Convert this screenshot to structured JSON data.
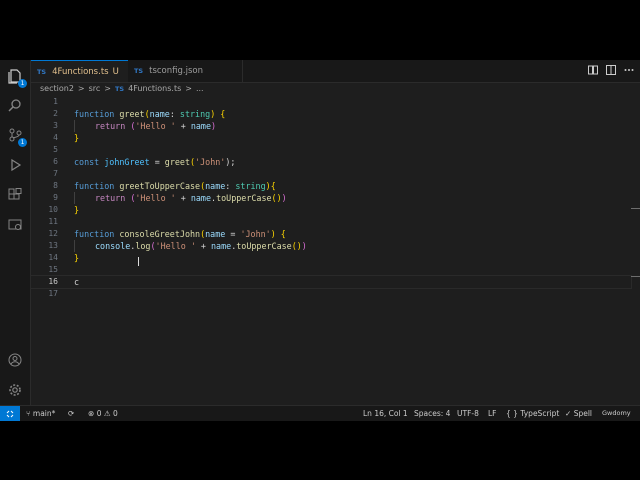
{
  "tabs": [
    {
      "badge": "TS",
      "label": "4Functions.ts",
      "modified": "U"
    },
    {
      "badge": "TS",
      "label": "tsconfig.json"
    }
  ],
  "breadcrumb": [
    "section2",
    ">",
    "src",
    ">",
    "TS",
    "4Functions.ts",
    ">",
    "..."
  ],
  "activity": {
    "explorer_badge": "1",
    "scm_badge": "1"
  },
  "lines": [
    "1",
    "2",
    "3",
    "4",
    "5",
    "6",
    "7",
    "8",
    "9",
    "10",
    "11",
    "12",
    "13",
    "14",
    "15",
    "16",
    "17"
  ],
  "code": {
    "l2": [
      "function",
      "greet",
      "(",
      "name",
      ": ",
      "string",
      ") {"
    ],
    "l3": [
      "return",
      "(",
      "'Hello '",
      " + ",
      "name",
      ")"
    ],
    "l4": "}",
    "l6": [
      "const",
      "johnGreet",
      " = ",
      "greet",
      "(",
      "'John'",
      ");"
    ],
    "l8": [
      "function",
      "greetToUpperCase",
      "(",
      "name",
      ": ",
      "string",
      "){"
    ],
    "l9": [
      "return",
      "(",
      "'Hello '",
      " + ",
      "name",
      ".",
      "toUpperCase",
      "()",
      ")"
    ],
    "l10": "}",
    "l12": [
      "function",
      "consoleGreetJohn",
      "(",
      "name",
      " = ",
      "'John'",
      ") {"
    ],
    "l13": [
      "console",
      ".",
      "log",
      "(",
      "'Hello '",
      " + ",
      "name",
      ".",
      "toUpperCase",
      "()",
      ")"
    ],
    "l14": "}",
    "l16": "c"
  },
  "status": {
    "branch": "main*",
    "errors": "0",
    "warnings": "0",
    "position": "Ln 16, Col 1",
    "spaces": "Spaces: 4",
    "encoding": "UTF-8",
    "eol": "LF",
    "language": "TypeScript",
    "spell": "Spell",
    "extra": "Gwdomy"
  },
  "colors": {
    "accent": "#0078d4",
    "bg": "#1e1e1e",
    "sidebar": "#181818"
  }
}
